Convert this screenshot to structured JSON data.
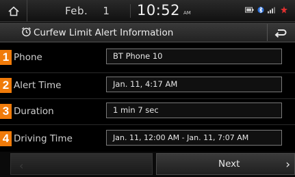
{
  "status": {
    "home_icon": "home-icon",
    "month": "Feb.",
    "day": "1",
    "time": "10:52",
    "ampm": "AM",
    "icons": [
      "battery-icon",
      "bluetooth-icon",
      "signal-icon",
      "alert-icon"
    ]
  },
  "header": {
    "title": "Curfew Limit Alert Information",
    "title_icon": "alarm-clock-icon",
    "back_icon": "back-arrow-icon"
  },
  "rows": [
    {
      "number": "1",
      "label": "Phone",
      "value": "BT Phone 10"
    },
    {
      "number": "2",
      "label": "Alert Time",
      "value": "Jan. 11, 4:17 AM"
    },
    {
      "number": "3",
      "label": "Duration",
      "value": "1 min  7 sec"
    },
    {
      "number": "4",
      "label": "Driving Time",
      "value": "Jan. 11, 12:00 AM - Jan. 11, 7:07 AM"
    }
  ],
  "buttons": {
    "next_label": "Next"
  },
  "colors": {
    "accent": "#f07b0a",
    "background": "#000000"
  }
}
